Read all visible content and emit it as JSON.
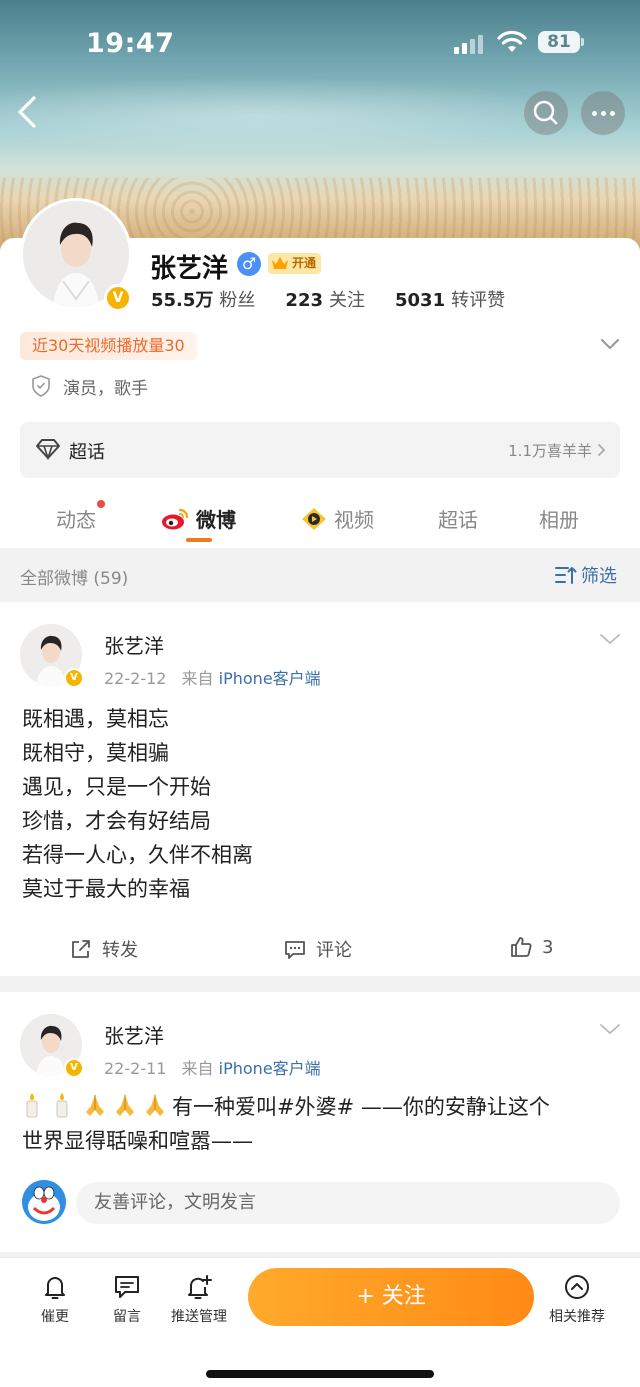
{
  "status_bar": {
    "time": "19:47",
    "battery": "81"
  },
  "profile": {
    "name": "张艺洋",
    "vip_label": "开通",
    "stats": [
      {
        "num": "55.5万",
        "label": "粉丝"
      },
      {
        "num": "223",
        "label": "关注"
      },
      {
        "num": "5031",
        "label": "转评赞"
      }
    ],
    "views_tag": "近30天视频播放量30",
    "identity": "演员，歌手",
    "supertopic": {
      "label": "超话",
      "count": "1.1万喜羊羊"
    }
  },
  "tabs": [
    "动态",
    "微博",
    "视频",
    "超话",
    "相册"
  ],
  "filter_bar": {
    "all_label": "全部微博 (59)",
    "filter_label": "筛选"
  },
  "posts": [
    {
      "author": "张艺洋",
      "date": "22-2-12",
      "from": "来自",
      "source": "iPhone客户端",
      "lines": [
        "既相遇，莫相忘",
        "既相守，莫相骗",
        "遇见，只是一个开始",
        "珍惜，才会有好结局",
        "若得一人心，久伴不相离",
        "莫过于最大的幸福"
      ],
      "actions": {
        "repost": "转发",
        "comment": "评论",
        "like": "3"
      }
    },
    {
      "author": "张艺洋",
      "date": "22-2-11",
      "from": "来自",
      "source": "iPhone客户端",
      "text_before": "有一种爱叫",
      "hashtag": "#外婆#",
      "text_after": " ——你的安静让这个",
      "text_line2": "世界显得聒噪和喧嚣——",
      "comment_placeholder": "友善评论，文明发言"
    }
  ],
  "bottom_bar": {
    "items": [
      "催更",
      "留言",
      "推送管理"
    ],
    "follow": "+ 关注",
    "recommend": "相关推荐"
  },
  "colors": {
    "accent": "#ff8a15",
    "link": "#3b6fa9",
    "badge": "#f5b400"
  }
}
